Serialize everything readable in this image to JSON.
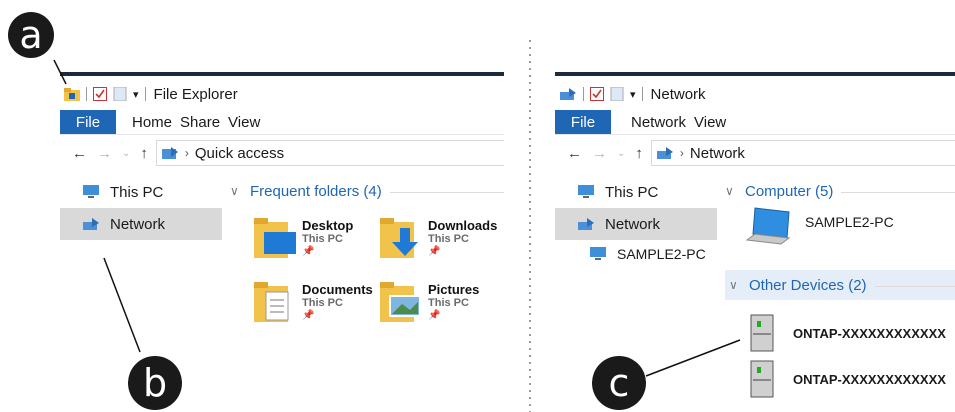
{
  "callouts": {
    "a": "a",
    "b": "b",
    "c": "c"
  },
  "left": {
    "window_title": "File Explorer",
    "ribbon": {
      "file": "File",
      "tabs": [
        "Home",
        "Share",
        "View"
      ]
    },
    "address": {
      "path": "Quick access"
    },
    "nav": {
      "this_pc": "This PC",
      "network": "Network"
    },
    "group_title": "Frequent folders (4)",
    "folders": [
      {
        "name": "Desktop",
        "location": "This PC"
      },
      {
        "name": "Downloads",
        "location": "This PC"
      },
      {
        "name": "Documents",
        "location": "This PC"
      },
      {
        "name": "Pictures",
        "location": "This PC"
      }
    ]
  },
  "right": {
    "window_title": "Network",
    "ribbon": {
      "file": "File",
      "tabs": [
        "Network",
        "View"
      ]
    },
    "address": {
      "path": "Network"
    },
    "nav": {
      "this_pc": "This PC",
      "network": "Network",
      "sample_pc": "SAMPLE2-PC"
    },
    "computer_group": "Computer (5)",
    "computer_name": "SAMPLE2-PC",
    "other_group": "Other Devices (2)",
    "devices": [
      "ONTAP-XXXXXXXXXXXX",
      "ONTAP-XXXXXXXXXXXX"
    ]
  },
  "colors": {
    "accent": "#1f66b5",
    "selection": "#d9d9d9",
    "callout": "#1a1a1a"
  }
}
